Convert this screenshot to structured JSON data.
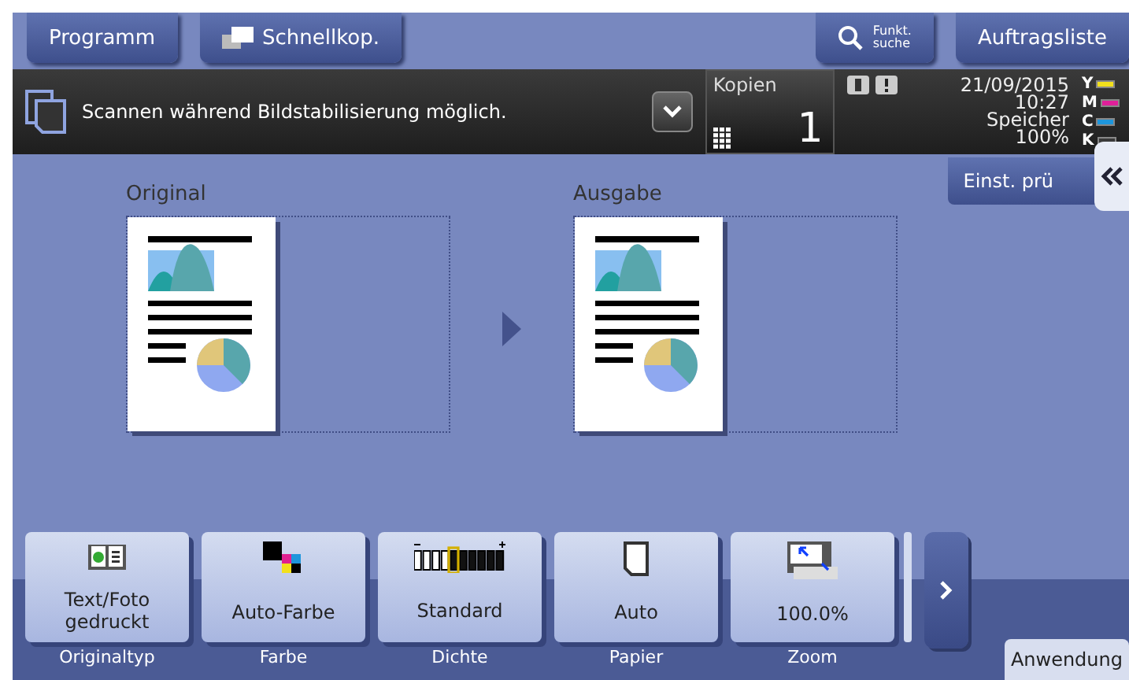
{
  "top_left_buttons": [
    {
      "label": "Programm",
      "kind": "plain"
    },
    {
      "label": "Schnellkop.",
      "kind": "quick-copy"
    }
  ],
  "top_right_buttons": [
    {
      "label": "Funkt.\nsuche",
      "kind": "search"
    },
    {
      "label": "Auftragsliste",
      "kind": "plain"
    }
  ],
  "status": {
    "message": "Scannen während Bildstabilisierung möglich.",
    "copies_label": "Kopien",
    "copies": "1",
    "date": "21/09/2015",
    "time": "10:27",
    "memory_label": "Speicher",
    "memory": "100%",
    "toner": [
      {
        "label": "Y",
        "color": "#f2e01c"
      },
      {
        "label": "M",
        "color": "#e0209a"
      },
      {
        "label": "C",
        "color": "#1e96dc"
      },
      {
        "label": "K",
        "color": "#3a3a3a"
      }
    ]
  },
  "settings_button": "Einst. prü",
  "preview": {
    "original_label": "Original",
    "output_label": "Ausgabe"
  },
  "functions": [
    {
      "value": "Text/Foto gedruckt",
      "caption": "Originaltyp",
      "kind": "original-type"
    },
    {
      "value": "Auto-Farbe",
      "caption": "Farbe",
      "kind": "color"
    },
    {
      "value": "Standard",
      "caption": "Dichte",
      "kind": "density"
    },
    {
      "value": "Auto",
      "caption": "Papier",
      "kind": "paper"
    },
    {
      "value": "100.0%",
      "caption": "Zoom",
      "kind": "zoom"
    }
  ],
  "bottom_tab": "Anwendung"
}
